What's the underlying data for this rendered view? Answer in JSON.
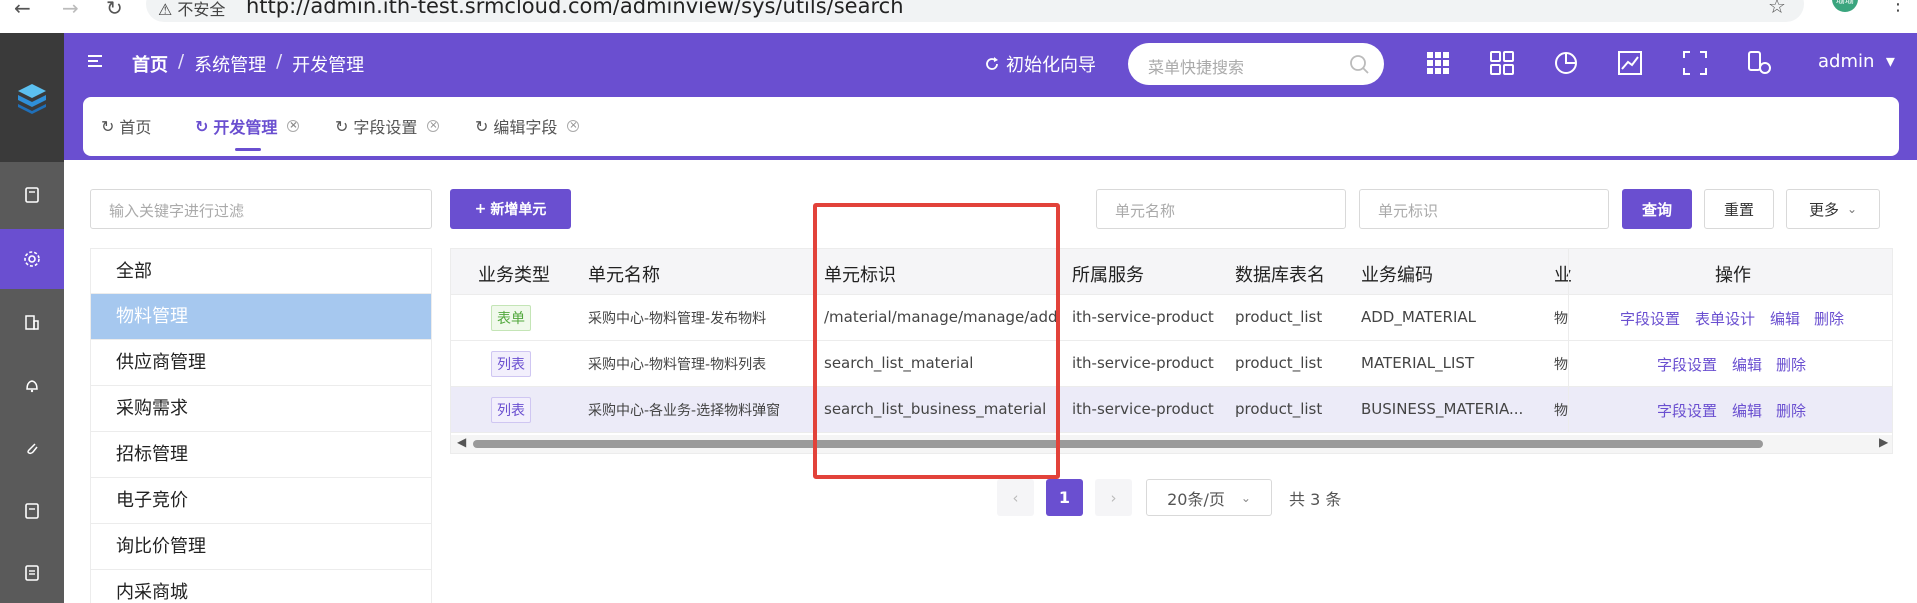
{
  "browser": {
    "back": "←",
    "forward": "→",
    "reload": "↻",
    "security": "⚠ 不安全",
    "url": "http://admin.ith-test.srmcloud.com/adminview/sys/utils/search",
    "profile": "珊珊"
  },
  "header": {
    "breadcrumbs": [
      "首页",
      "系统管理",
      "开发管理"
    ],
    "separator": "/",
    "guide_label": "初始化向导",
    "search_placeholder": "菜单快捷搜索",
    "user": "admin"
  },
  "tabs": [
    {
      "label": "首页",
      "closable": false,
      "active": false
    },
    {
      "label": "开发管理",
      "closable": true,
      "active": true
    },
    {
      "label": "字段设置",
      "closable": true,
      "active": false
    },
    {
      "label": "编辑字段",
      "closable": true,
      "active": false
    }
  ],
  "filter_placeholder": "输入关键字进行过滤",
  "categories": [
    {
      "label": "全部",
      "active": false
    },
    {
      "label": "物料管理",
      "active": true
    },
    {
      "label": "供应商管理",
      "active": false
    },
    {
      "label": "采购需求",
      "active": false
    },
    {
      "label": "招标管理",
      "active": false
    },
    {
      "label": "电子竞价",
      "active": false
    },
    {
      "label": "询比价管理",
      "active": false
    },
    {
      "label": "内采商城",
      "active": false
    }
  ],
  "toolbar": {
    "add_label": "新增单元",
    "unit_name_placeholder": "单元名称",
    "unit_id_placeholder": "单元标识",
    "query_label": "查询",
    "reset_label": "重置",
    "more_label": "更多"
  },
  "table": {
    "columns": [
      "业务类型",
      "单元名称",
      "单元标识",
      "所属服务",
      "数据库表名",
      "业务编码",
      "业",
      "操作"
    ],
    "rows": [
      {
        "type": "表单",
        "type_color": "green",
        "name": "采购中心-物料管理-发布物料",
        "id": "/material/manage/manage/add",
        "service": "ith-service-product",
        "table": "product_list",
        "code": "ADD_MATERIAL",
        "extra": "物",
        "ops": [
          "字段设置",
          "表单设计",
          "编辑",
          "删除"
        ]
      },
      {
        "type": "列表",
        "type_color": "purple",
        "name": "采购中心-物料管理-物料列表",
        "id": "search_list_material",
        "service": "ith-service-product",
        "table": "product_list",
        "code": "MATERIAL_LIST",
        "extra": "物",
        "ops": [
          "字段设置",
          "编辑",
          "删除"
        ]
      },
      {
        "type": "列表",
        "type_color": "purple",
        "name": "采购中心-各业务-选择物料弹窗",
        "id": "search_list_business_material",
        "service": "ith-service-product",
        "table": "product_list",
        "code": "BUSINESS_MATERIA...",
        "extra": "物",
        "ops": [
          "字段设置",
          "编辑",
          "删除"
        ]
      }
    ]
  },
  "pagination": {
    "current": "1",
    "page_size": "20条/页",
    "total": "共 3 条"
  },
  "colors": {
    "primary": "#6a4fd0",
    "selected_category": "#a6c8ef",
    "highlight": "#e2423a"
  }
}
